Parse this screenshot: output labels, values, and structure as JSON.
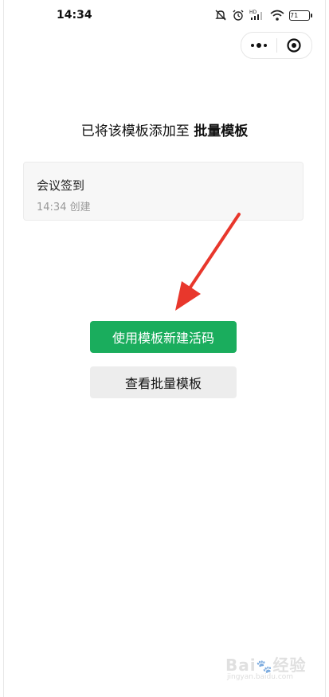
{
  "status_bar": {
    "time": "14:34",
    "battery": "71",
    "icons": [
      "mute-icon",
      "alarm-icon",
      "hd-signal-icon",
      "wifi-icon",
      "battery-icon"
    ]
  },
  "capsule": {
    "more_icon": "more-dots-icon",
    "close_icon": "target-close-icon"
  },
  "message": {
    "prefix": "已将该模板添加至 ",
    "highlight": "批量模板"
  },
  "template_card": {
    "title": "会议签到",
    "time": "14:34",
    "created_label": "创建"
  },
  "buttons": {
    "primary_label": "使用模板新建活码",
    "secondary_label": "查看批量模板"
  },
  "colors": {
    "primary_green": "#1aad5d",
    "arrow_red": "#e8372c",
    "card_bg": "#f7f7f7"
  },
  "watermark": {
    "main": "Baidu经验",
    "sub": "jingyan.baidu.com"
  }
}
